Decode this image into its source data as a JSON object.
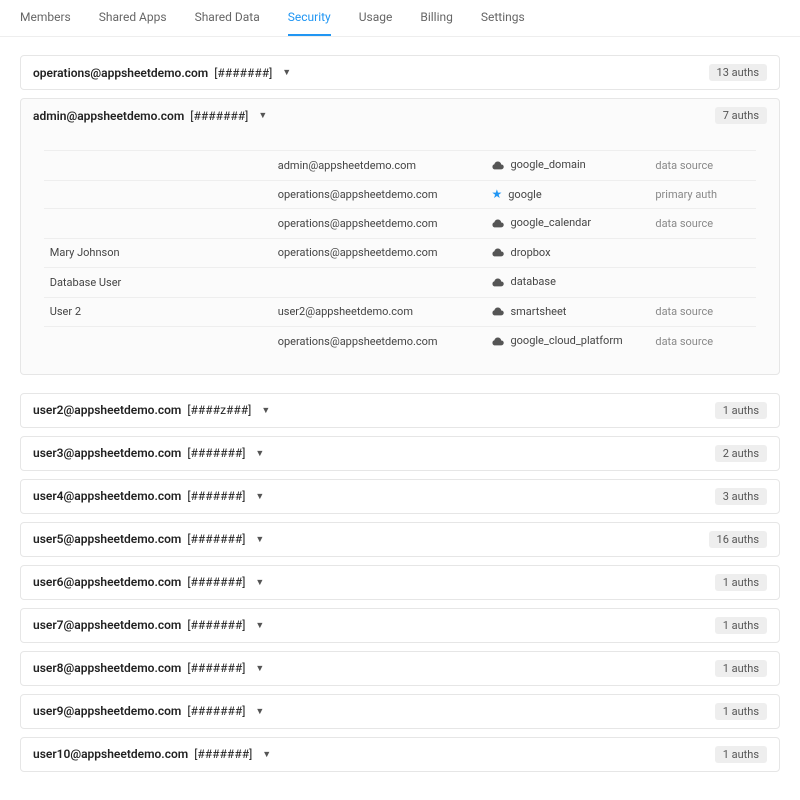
{
  "tabs": [
    {
      "label": "Members",
      "active": false
    },
    {
      "label": "Shared Apps",
      "active": false
    },
    {
      "label": "Shared Data",
      "active": false
    },
    {
      "label": "Security",
      "active": true
    },
    {
      "label": "Usage",
      "active": false
    },
    {
      "label": "Billing",
      "active": false
    },
    {
      "label": "Settings",
      "active": false
    }
  ],
  "users": [
    {
      "email": "operations@appsheetdemo.com",
      "id_mask": "[#######]",
      "badge": "13 auths",
      "expanded": false
    },
    {
      "email": "admin@appsheetdemo.com",
      "id_mask": "[#######]",
      "badge": "7 auths",
      "expanded": true,
      "auths": [
        {
          "name": "",
          "account": "admin@appsheetdemo.com",
          "provider": "google_domain",
          "type": "data source",
          "icon": "cloud"
        },
        {
          "name": "",
          "account": "operations@appsheetdemo.com",
          "provider": "google",
          "type": "primary auth",
          "icon": "star"
        },
        {
          "name": "",
          "account": "operations@appsheetdemo.com",
          "provider": "google_calendar",
          "type": "data source",
          "icon": "cloud"
        },
        {
          "name": "Mary Johnson",
          "account": "operations@appsheetdemo.com",
          "provider": "dropbox",
          "type": "",
          "icon": "cloud"
        },
        {
          "name": "Database User",
          "account": "",
          "provider": "database",
          "type": "",
          "icon": "cloud"
        },
        {
          "name": "User 2",
          "account": "user2@appsheetdemo.com",
          "provider": "smartsheet",
          "type": "data source",
          "icon": "cloud"
        },
        {
          "name": "",
          "account": "operations@appsheetdemo.com",
          "provider": "google_cloud_platform",
          "type": "data source",
          "icon": "cloud"
        }
      ]
    },
    {
      "email": "user2@appsheetdemo.com",
      "id_mask": "[####z###]",
      "badge": "1 auths",
      "expanded": false
    },
    {
      "email": "user3@appsheetdemo.com",
      "id_mask": "[#######]",
      "badge": "2 auths",
      "expanded": false
    },
    {
      "email": "user4@appsheetdemo.com",
      "id_mask": "[#######]",
      "badge": "3 auths",
      "expanded": false
    },
    {
      "email": "user5@appsheetdemo.com",
      "id_mask": "[#######]",
      "badge": "16 auths",
      "expanded": false
    },
    {
      "email": "user6@appsheetdemo.com",
      "id_mask": "[#######]",
      "badge": "1 auths",
      "expanded": false
    },
    {
      "email": "user7@appsheetdemo.com",
      "id_mask": "[#######]",
      "badge": "1 auths",
      "expanded": false
    },
    {
      "email": "user8@appsheetdemo.com",
      "id_mask": "[#######]",
      "badge": "1 auths",
      "expanded": false
    },
    {
      "email": "user9@appsheetdemo.com",
      "id_mask": "[#######]",
      "badge": "1 auths",
      "expanded": false
    },
    {
      "email": "user10@appsheetdemo.com",
      "id_mask": "[#######]",
      "badge": "1 auths",
      "expanded": false
    }
  ]
}
